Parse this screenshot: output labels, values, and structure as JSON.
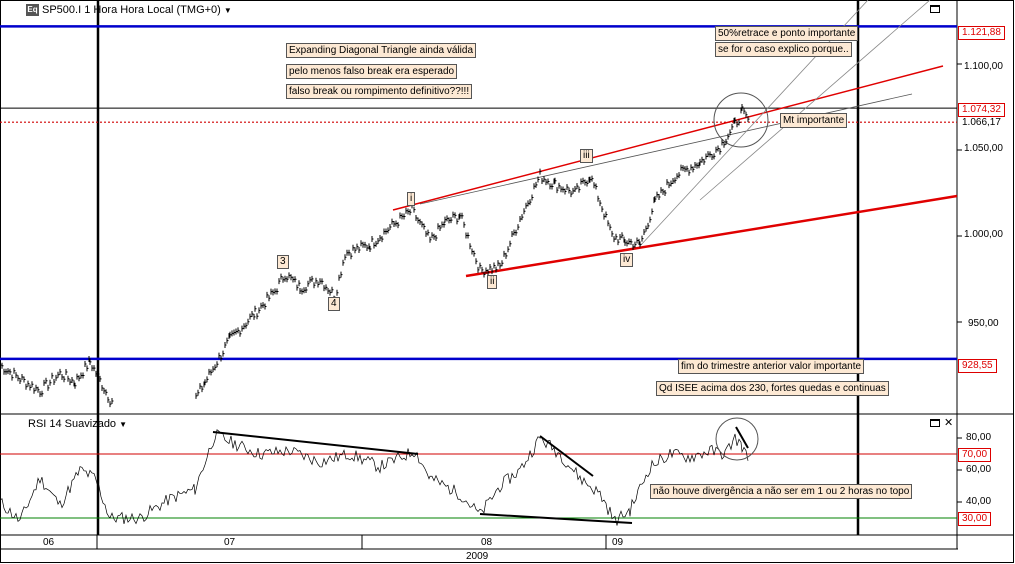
{
  "header": {
    "title": "SP500.I 1 Hora Hora Local (TMG+0)",
    "logo": "Eq"
  },
  "rsi_header": {
    "title": "RSI 14 Suavizado"
  },
  "annotations": {
    "a1": "Expanding Diagonal Triangle ainda válida",
    "a2": "pelo menos falso break era esperado",
    "a3": "falso break ou rompimento definitivo??!!!",
    "a4": "50%retrace e ponto importante",
    "a5": "se for o caso explico porque..",
    "a6": "Mt importante",
    "a7": "fim do trimestre anterior valor importante",
    "a8": "Qd ISEE acima dos 230, fortes quedas e continuas",
    "a9": "não houve divergência a não ser em 1 ou 2 horas no topo"
  },
  "waves": {
    "w1": "i",
    "w2": "ii",
    "w3": "iii",
    "w4": "iv",
    "wa": "3",
    "wb": "4"
  },
  "price_axis": {
    "t1": "1.100,00",
    "t2": "1.050,00",
    "t3": "1.000,00",
    "t4": "950,00"
  },
  "price_tags": {
    "p1": "1.121,88",
    "p2": "1.074,32",
    "p3": "1.066,17",
    "p4": "928,55"
  },
  "rsi_axis": {
    "t1": "80,00",
    "t2": "60,00",
    "t3": "40,00"
  },
  "rsi_tags": {
    "r1": "70,00",
    "r2": "30,00"
  },
  "time_axis": {
    "m1": "06",
    "m2": "07",
    "m3": "08",
    "m4": "09",
    "year": "2009"
  },
  "colors": {
    "support": "#0000cc",
    "trendline": "#e00000",
    "price": "#000000",
    "levels": "#d00000",
    "oversold": "#008000"
  },
  "chart_data": [
    {
      "type": "line",
      "series": [
        {
          "name": "SP500.I",
          "x": [
            "06",
            "07",
            "07",
            "07",
            "07",
            "08",
            "08",
            "08",
            "08",
            "09",
            "09",
            "09"
          ],
          "values": [
            920,
            955,
            980,
            1010,
            1015,
            980,
            1040,
            1030,
            995,
            1050,
            1068,
            1066
          ]
        }
      ],
      "yrange": [
        885,
        1135
      ],
      "levels": {
        "resistance": 1121.88,
        "last_high": 1074.32,
        "last": 1066.17,
        "support": 928.55
      }
    },
    {
      "type": "line",
      "series": [
        {
          "name": "RSI 14 Suavizado",
          "values": [
            35,
            55,
            40,
            85,
            70,
            72,
            60,
            30,
            65,
            82,
            70,
            65
          ]
        }
      ],
      "yrange": [
        20,
        90
      ],
      "levels": {
        "overbought": 70,
        "oversold": 30
      }
    }
  ]
}
